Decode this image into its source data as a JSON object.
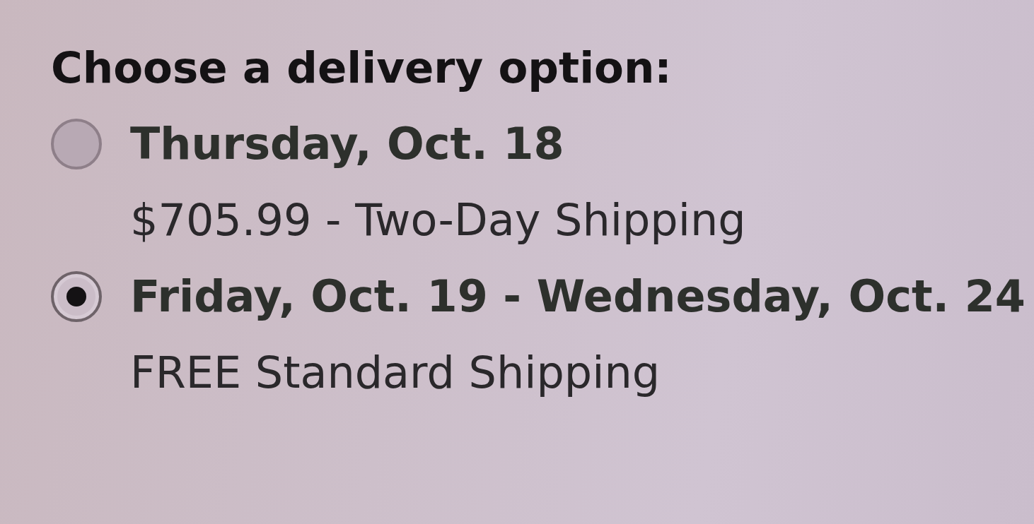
{
  "heading": "Choose a delivery option:",
  "options": [
    {
      "date": "Thursday, Oct. 18",
      "detail": "$705.99 - Two-Day Shipping",
      "selected": false
    },
    {
      "date": "Friday, Oct. 19 - Wednesday, Oct. 24",
      "detail": "FREE Standard Shipping",
      "selected": true
    }
  ]
}
